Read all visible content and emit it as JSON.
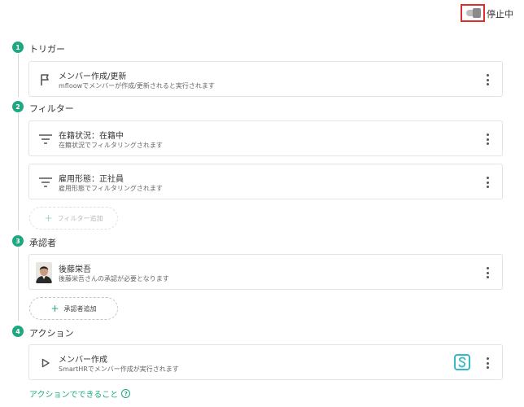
{
  "status": {
    "label": "停止中"
  },
  "sections": {
    "trigger": {
      "num": "1",
      "title": "トリガー"
    },
    "filter": {
      "num": "2",
      "title": "フィルター"
    },
    "approver": {
      "num": "3",
      "title": "承認者"
    },
    "action": {
      "num": "4",
      "title": "アクション"
    }
  },
  "trigger_card": {
    "title": "メンバー作成/更新",
    "subtitle": "mfloowでメンバーが作成/更新されると実行されます",
    "icon": "flag-icon"
  },
  "filters": [
    {
      "title": "在籍状況：在籍中",
      "subtitle": "在籍状況でフィルタリングされます",
      "icon": "filter-icon"
    },
    {
      "title": "雇用形態：正社員",
      "subtitle": "雇用形態でフィルタリングされます",
      "icon": "filter-icon"
    }
  ],
  "add_filter": {
    "label": "フィルター追加"
  },
  "approver_card": {
    "title": "後藤栄吾",
    "subtitle": "後藤栄吾さんの承認が必要となります",
    "icon": "avatar"
  },
  "add_approver": {
    "label": "承認者追加"
  },
  "action_card": {
    "title": "メンバー作成",
    "subtitle": "SmartHRでメンバー作成が実行されます",
    "icon": "play-icon",
    "badge_icon": "smarthr-icon"
  },
  "help_link": {
    "label": "アクションでできること",
    "icon": "help-icon"
  },
  "colors": {
    "accent": "#1ea882",
    "highlight": "#d9302a",
    "smarthr": "#35b9c6"
  }
}
